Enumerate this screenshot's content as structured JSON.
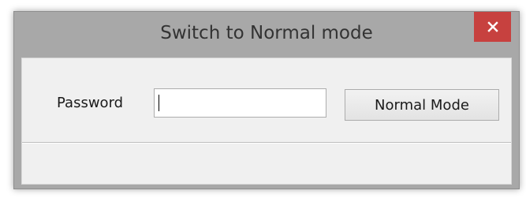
{
  "window": {
    "title": "Switch to Normal mode",
    "close_icon": "close-icon"
  },
  "form": {
    "password_label": "Password",
    "password_value": "",
    "normal_mode_button": "Normal Mode"
  },
  "colors": {
    "frame": "#a8a8a8",
    "close_button": "#c7413f",
    "client_background": "#f0f0f0"
  }
}
